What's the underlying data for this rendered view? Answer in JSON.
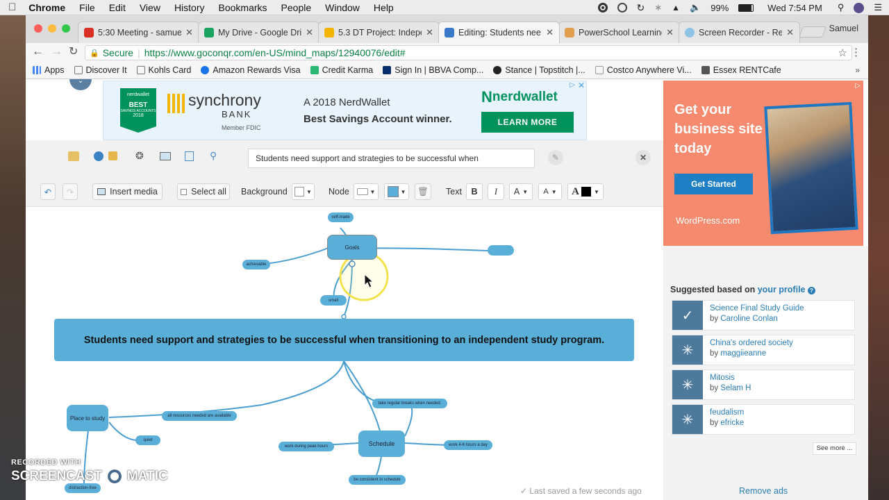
{
  "menubar": {
    "app": "Chrome",
    "items": [
      "File",
      "Edit",
      "View",
      "History",
      "Bookmarks",
      "People",
      "Window",
      "Help"
    ],
    "battery": "99%",
    "clock": "Wed 7:54 PM"
  },
  "tabs": [
    {
      "title": "5:30 Meeting - samue",
      "color": "#d93025"
    },
    {
      "title": "My Drive - Google Dri",
      "color": "#1aa260"
    },
    {
      "title": "5.3 DT Project: Indepe",
      "color": "#f4b400"
    },
    {
      "title": "Editing: Students nee",
      "color": "#3a78c9"
    },
    {
      "title": "PowerSchool Learning",
      "color": "#e0a050"
    },
    {
      "title": "Screen Recorder - Re",
      "color": "#8fc3e6"
    }
  ],
  "profile": "Samuel",
  "address": {
    "secure": "Secure",
    "url": "https://www.goconqr.com/en-US/mind_maps/12940076/edit#"
  },
  "bookmarks": [
    {
      "label": "Apps",
      "color": "#4285f4"
    },
    {
      "label": "Discover It",
      "color": "#ffffff"
    },
    {
      "label": "Kohls Card",
      "color": "#ffffff"
    },
    {
      "label": "Amazon Rewards Visa",
      "color": "#1a73e8"
    },
    {
      "label": "Credit Karma",
      "color": "#2bb673"
    },
    {
      "label": "Sign In | BBVA Comp...",
      "color": "#0a2d6e"
    },
    {
      "label": "Stance | Topstitch |...",
      "color": "#222222"
    },
    {
      "label": "Costco Anywhere Vi...",
      "color": "#ffffff"
    },
    {
      "label": "Essex RENTCafe",
      "color": "#555555"
    }
  ],
  "ad_top": {
    "badge_brand": "nerdwallet",
    "badge_best": "BEST",
    "badge_sub": "SAVINGS ACCOUNTS",
    "badge_year": "2018",
    "bank": "synchrony",
    "bank2": "BANK",
    "fdic": "Member FDIC",
    "line1": "A 2018 NerdWallet",
    "line2": "Best Savings Account winner.",
    "brand": "nerdwallet",
    "cta": "LEARN MORE"
  },
  "ad_right": {
    "headline": "Get your business site today",
    "cta": "Get Started",
    "brand": "WordPress.com"
  },
  "editor": {
    "title_value": "Students need support and strategies to be successful when",
    "insert_media": "Insert media",
    "select_all": "Select all",
    "background": "Background",
    "node": "Node",
    "text": "Text",
    "bold": "B",
    "italic": "I",
    "fontsize": "A",
    "case": "A",
    "color": "A",
    "saved": "Last saved a few seconds ago"
  },
  "mindmap": {
    "central": "Students need support and strategies to be successful when transitioning to an independent study program.",
    "goals": "Goals",
    "self_made": "self-made",
    "achievable": "achievable",
    "small": "small",
    "blank": "",
    "place": "Place to study",
    "resources": "all resources needed are available",
    "quiet": "quiet",
    "distraction": "distraction-free",
    "schedule": "Schedule",
    "breaks": "take regular breaks when needed.",
    "peak": "work during peak hours",
    "hours": "work 4-6 hours a day",
    "consistent": "be consistent in schedule"
  },
  "sidebar": {
    "heading": "Suggested based on",
    "heading_link": "your profile",
    "items": [
      {
        "title": "Science Final Study Guide",
        "by": "by",
        "author": "Caroline Conlan"
      },
      {
        "title": "China's ordered society",
        "by": "by",
        "author": "maggiieanne"
      },
      {
        "title": "Mitosis",
        "by": "by",
        "author": "Selam H"
      },
      {
        "title": "feudalism",
        "by": "by",
        "author": "efricke"
      }
    ],
    "see_more": "See more ...",
    "remove_ads": "Remove ads"
  },
  "watermark": {
    "line1": "RECORDED WITH",
    "line2a": "SCREENCAST",
    "line2b": "MATIC"
  }
}
